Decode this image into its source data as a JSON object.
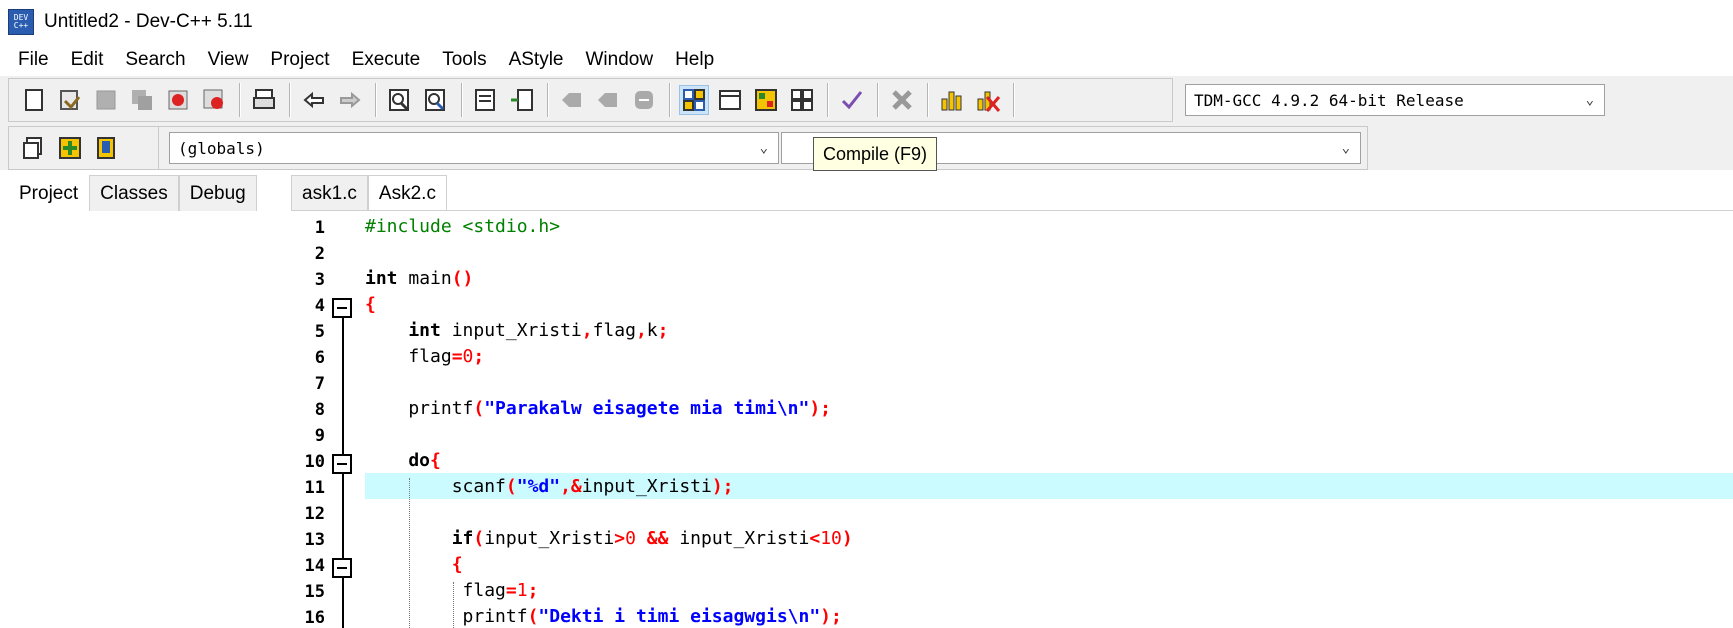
{
  "window": {
    "title": "Untitled2 - Dev-C++ 5.11",
    "icon_text": "DEV C++"
  },
  "menu": [
    "File",
    "Edit",
    "Search",
    "View",
    "Project",
    "Execute",
    "Tools",
    "AStyle",
    "Window",
    "Help"
  ],
  "toolbar": {
    "compiler_select": "TDM-GCC 4.9.2 64-bit Release",
    "scope_select": "(globals)",
    "function_select": "",
    "tooltip": "Compile (F9)"
  },
  "left_panel": {
    "tabs": [
      "Project",
      "Classes",
      "Debug"
    ],
    "active_tab": "Project"
  },
  "editor": {
    "tabs": [
      "ask1.c",
      "Ask2.c"
    ],
    "active_tab": "Ask2.c",
    "current_line": 11,
    "lines": [
      {
        "n": "1",
        "code": "#include <stdio.h>"
      },
      {
        "n": "2",
        "code": ""
      },
      {
        "n": "3",
        "code": "int main()"
      },
      {
        "n": "4",
        "code": "{"
      },
      {
        "n": "5",
        "code": "    int input_Xristi,flag,k;"
      },
      {
        "n": "6",
        "code": "    flag=0;"
      },
      {
        "n": "7",
        "code": ""
      },
      {
        "n": "8",
        "code": "    printf(\"Parakalw eisagete mia timi\\n\");"
      },
      {
        "n": "9",
        "code": ""
      },
      {
        "n": "10",
        "code": "    do{"
      },
      {
        "n": "11",
        "code": "        scanf(\"%d\",&input_Xristi);"
      },
      {
        "n": "12",
        "code": ""
      },
      {
        "n": "13",
        "code": "        if(input_Xristi>0 && input_Xristi<10)"
      },
      {
        "n": "14",
        "code": "        {"
      },
      {
        "n": "15",
        "code": "         flag=1;"
      },
      {
        "n": "16",
        "code": "         printf(\"Dekti i timi eisagwgis\\n\");"
      }
    ]
  },
  "colors": {
    "preprocessor": "#008000",
    "string": "#0000ff",
    "number": "#ff0000",
    "symbol": "#ff0000",
    "keyword": "#000000",
    "current_line_bg": "#ccfbff"
  }
}
